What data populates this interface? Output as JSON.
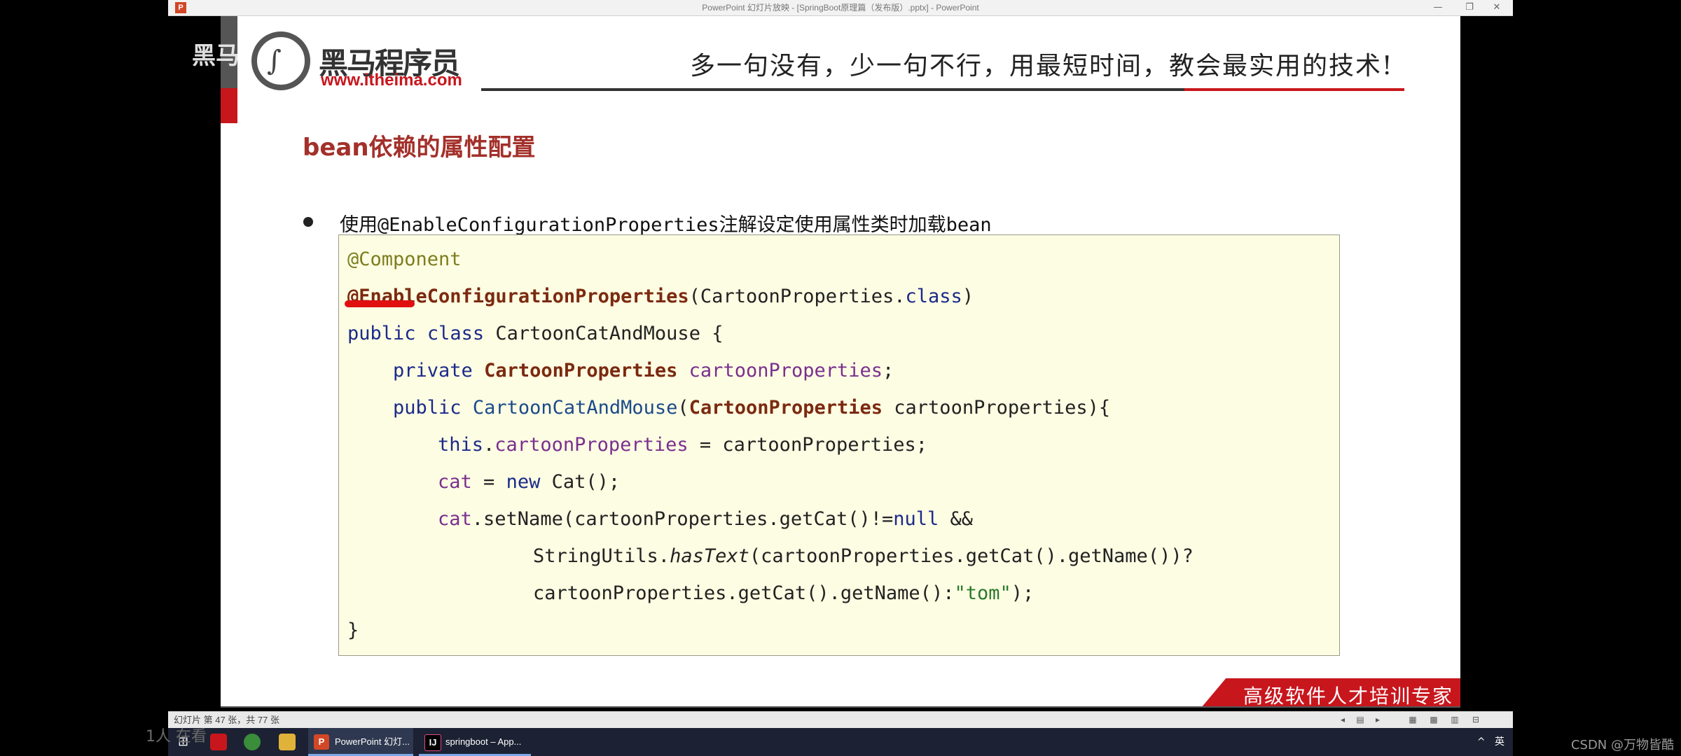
{
  "window": {
    "title": "PowerPoint 幻灯片放映 - [SpringBoot原理篇（发布版）.pptx] - PowerPoint",
    "app_icon": "P",
    "minimize_glyph": "—",
    "restore_glyph": "❐",
    "close_glyph": "✕"
  },
  "slide": {
    "logo": {
      "name": "黑马程序员",
      "url": "www.itheima.com",
      "mark": "∫"
    },
    "slogan": "多一句没有，少一句不行，用最短时间，教会最实用的技术!",
    "title": "bean依赖的属性配置",
    "bullet": "使用@EnableConfigurationProperties注解设定使用属性类时加载bean",
    "code": {
      "l1": "@Component",
      "l2_ann": "@EnableConfigurationProperties",
      "l2_rest": "(CartoonProperties.",
      "l2_kw": "class",
      "l2_end": ")",
      "l3_kw1": "public",
      "l3_kw2": "class",
      "l3_rest": " CartoonCatAndMouse {",
      "l4_kw": "private",
      "l4_type": "CartoonProperties",
      "l4_field": "cartoonProperties",
      "l4_end": ";",
      "l5_kw": "public",
      "l5_ctor": "CartoonCatAndMouse",
      "l5_paren": "(",
      "l5_type": "CartoonProperties",
      "l5_rest": " cartoonProperties){",
      "l6_kw": "this",
      "l6_dot": ".",
      "l6_field": "cartoonProperties",
      "l6_rest": " = cartoonProperties;",
      "l7_field": "cat",
      "l7_eq": " = ",
      "l7_kw": "new",
      "l7_rest": " Cat();",
      "l8_field": "cat",
      "l8_rest": ".setName(cartoonProperties.getCat()!=",
      "l8_kw": "null",
      "l8_end": " &&",
      "l9_pre": "StringUtils.",
      "l9_method": "hasText",
      "l9_rest": "(cartoonProperties.getCat().getName())?",
      "l10_pre": "cartoonProperties.getCat().getName():",
      "l10_str": "\"tom\"",
      "l10_end": ");",
      "l11": "}"
    },
    "footer": "高级软件人才培训专家"
  },
  "statusbar": {
    "text": "幻灯片 第 47 张，共 77 张",
    "icons": [
      "◂",
      "▤",
      "▸",
      "▦",
      "▩",
      "▥",
      "⊟"
    ]
  },
  "taskbar": {
    "start_icon": "⊞",
    "apps": [
      {
        "label": "PowerPoint 幻灯...",
        "badge": "P"
      },
      {
        "label": "springboot – App...",
        "badge": "IJ"
      }
    ],
    "tray_chevron": "^",
    "ime": "英"
  },
  "overlays": {
    "brand": "黑马",
    "viewers": "1人 在看",
    "watermark": "CSDN @万物皆酷"
  },
  "colors": {
    "brand_red": "#c8161d",
    "title_red": "#a3302a",
    "code_bg": "#fdfde3"
  }
}
